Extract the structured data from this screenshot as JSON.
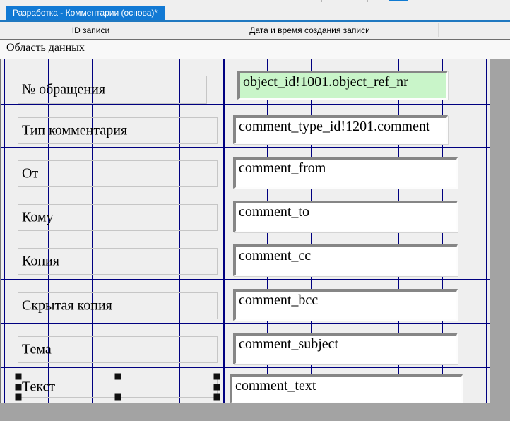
{
  "tab": {
    "title": "Разработка - Комментарии (основа)*"
  },
  "grid_header": {
    "col_id": "ID записи",
    "col_date": "Дата и время создания записи"
  },
  "band": {
    "title": "Область данных"
  },
  "rows": [
    {
      "label": "№ обращения",
      "field": "object_id!1001.object_ref_nr"
    },
    {
      "label": "Тип комментария",
      "field": "comment_type_id!1201.comment"
    },
    {
      "label": "От",
      "field": "comment_from"
    },
    {
      "label": "Кому",
      "field": "comment_to"
    },
    {
      "label": "Копия",
      "field": "comment_cc"
    },
    {
      "label": "Скрытая копия",
      "field": "comment_bcc"
    },
    {
      "label": "Тема",
      "field": "comment_subject"
    },
    {
      "label": "Текст",
      "field": "comment_text"
    }
  ],
  "colors": {
    "tab_blue": "#1179d4",
    "grid_line_navy": "#000080",
    "highlight_field_green": "#c9f5c9",
    "outside_gray": "#a3a3a3"
  }
}
